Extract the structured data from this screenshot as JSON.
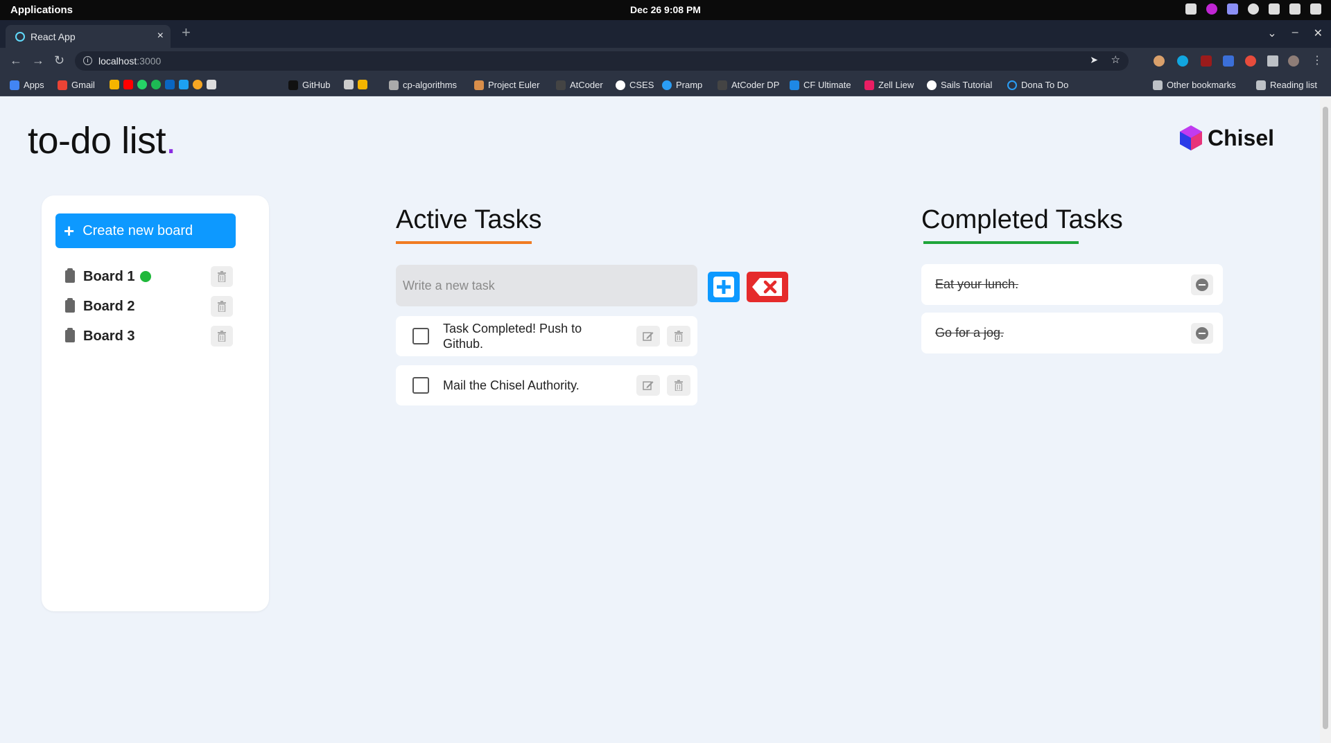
{
  "os": {
    "menu_label": "Applications",
    "clock": "Dec 26   9:08 PM"
  },
  "browser": {
    "tab_title": "React App",
    "tab_close": "×",
    "new_tab": "+",
    "url_host": "localhost",
    "url_port": ":3000",
    "bookmarks": [
      "Apps",
      "Gmail",
      "GitHub",
      "cp-algorithms",
      "Project Euler",
      "AtCoder",
      "CSES",
      "Pramp",
      "AtCoder DP",
      "CF Ultimate",
      "Zell Liew",
      "Sails Tutorial",
      "Dona To Do"
    ],
    "other_bookmarks": "Other bookmarks",
    "reading_list": "Reading list"
  },
  "header": {
    "logo_text": "to-do list",
    "logo_dot": ".",
    "brand_name": "Chisel"
  },
  "sidebar": {
    "create_label": "Create new board",
    "create_icon": "+",
    "boards": [
      {
        "name": "Board 1",
        "active": true
      },
      {
        "name": "Board 2",
        "active": false
      },
      {
        "name": "Board 3",
        "active": false
      }
    ]
  },
  "active": {
    "title": "Active Tasks",
    "accent": "#f07b22",
    "input_placeholder": "Write a new task",
    "tasks": [
      {
        "text": "Task Completed! Push to Github.",
        "checked": false
      },
      {
        "text": "Mail the Chisel Authority.",
        "checked": false
      }
    ]
  },
  "completed": {
    "title": "Completed Tasks",
    "accent": "#1fa53a",
    "tasks": [
      {
        "text": "Eat your lunch."
      },
      {
        "text": "Go for a jog."
      }
    ]
  },
  "colors": {
    "primary": "#0d99ff",
    "danger": "#e52b2b",
    "active_dot": "#1fb83a",
    "logo_dot": "#8a2be2",
    "page_bg": "#eef3fa"
  }
}
